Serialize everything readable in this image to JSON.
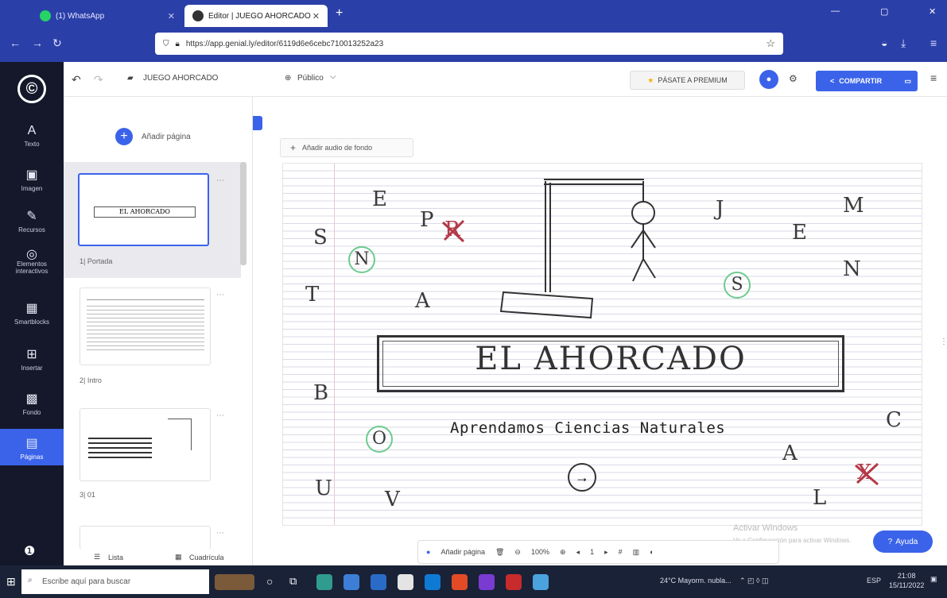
{
  "browser": {
    "tabs": [
      {
        "label": "(1) WhatsApp",
        "active": false
      },
      {
        "label": "Editor | JUEGO AHORCADO",
        "active": true
      }
    ],
    "new_tab": "+",
    "url": "https://app.genial.ly/editor/6119d6e6cebc710013252a23"
  },
  "rail": {
    "logo": "©",
    "items": [
      {
        "label": "Texto",
        "icon": "A"
      },
      {
        "label": "Imagen",
        "icon": "▣"
      },
      {
        "label": "Recursos",
        "icon": "✎"
      },
      {
        "label": "Elementos interactivos",
        "icon": "◎"
      },
      {
        "label": "Smartblocks",
        "icon": "▦"
      },
      {
        "label": "Insertar",
        "icon": "⊞"
      },
      {
        "label": "Fondo",
        "icon": "▩"
      },
      {
        "label": "Páginas",
        "icon": "▤"
      }
    ],
    "help_icon": "❶"
  },
  "topbar": {
    "undo": "↶",
    "redo": "↷",
    "doc_title": "JUEGO AHORCADO",
    "visibility": "Público",
    "premium": "PÁSATE A PREMIUM",
    "share": "COMPARTIR"
  },
  "panel": {
    "add_page": "Añadir página",
    "pages": [
      {
        "label": "1| Portada"
      },
      {
        "label": "2| Intro"
      },
      {
        "label": "3| 01"
      }
    ],
    "thumb1_title": "EL AHORCADO",
    "footer_list": "Lista",
    "footer_grid": "Cuadrícula"
  },
  "canvas": {
    "audio_button": "Añadir audio de fondo",
    "title": "EL AHORCADO",
    "subtitle": "Aprendamos Ciencias Naturales",
    "arrow": "→",
    "letters": {
      "s": "S",
      "e1": "E",
      "p": "P",
      "r": "R",
      "n1": "N",
      "t": "T",
      "a1": "A",
      "j": "J",
      "e2": "E",
      "m": "M",
      "n2": "N",
      "s2": "S",
      "b": "B",
      "o": "O",
      "c": "C",
      "a2": "A",
      "x": "X",
      "u": "U",
      "v": "V",
      "l": "L"
    }
  },
  "bottombar": {
    "add_page": "Añadir página",
    "zoom": "100%",
    "page": "1"
  },
  "watermark": {
    "line1": "Activar Windows",
    "line2": "Ve a Configuración para activar Windows."
  },
  "help": "Ayuda",
  "taskbar": {
    "search": "Escribe aquí para buscar",
    "weather": "24°C Mayorm. nubla...",
    "lang": "ESP",
    "time": "21:08",
    "date": "15/11/2022"
  },
  "colors": {
    "accent": "#3b63ea",
    "rail": "#14182a",
    "browser": "#2b3fa8",
    "circle": "#6ccb8e",
    "cross": "#b43a48"
  }
}
